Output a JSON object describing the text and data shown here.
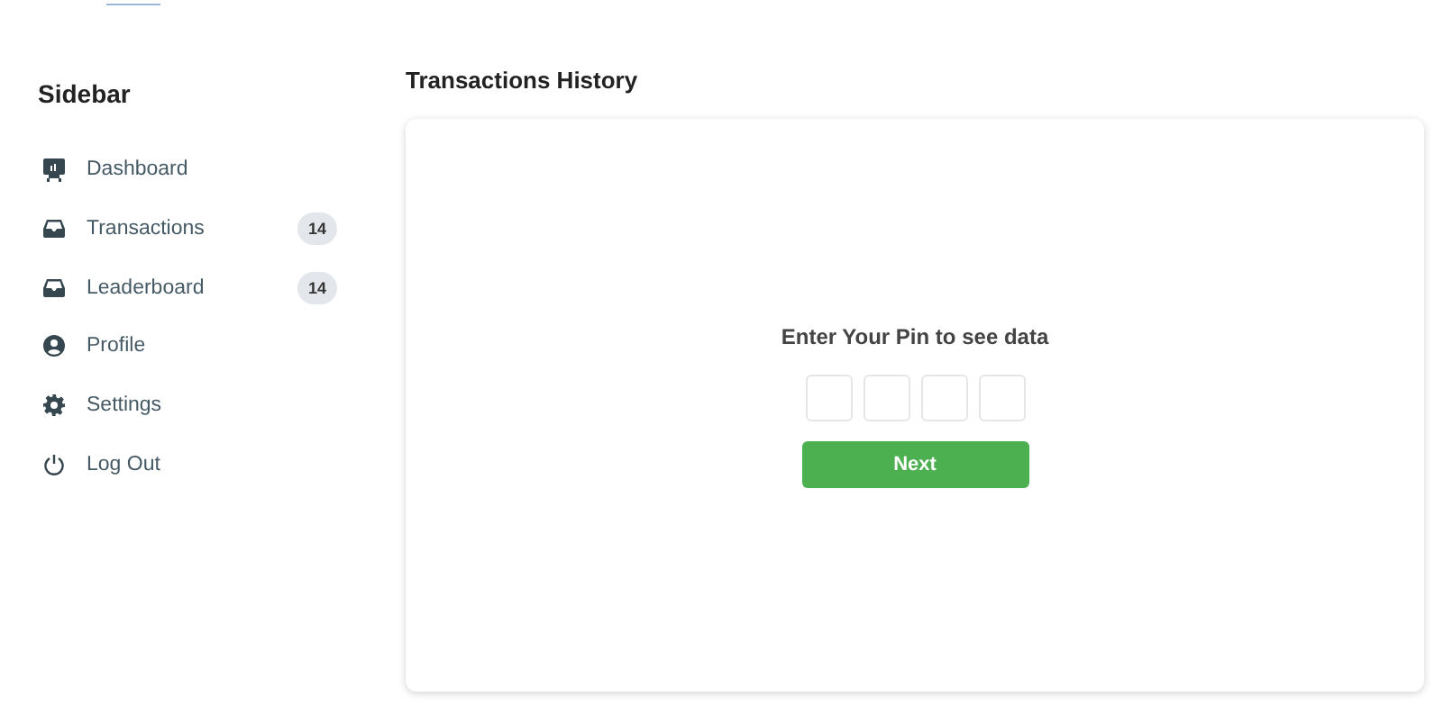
{
  "sidebar": {
    "title": "Sidebar",
    "items": [
      {
        "label": "Dashboard"
      },
      {
        "label": "Transactions",
        "badge": "14"
      },
      {
        "label": "Leaderboard",
        "badge": "14"
      },
      {
        "label": "Profile"
      },
      {
        "label": "Settings"
      },
      {
        "label": "Log Out"
      }
    ]
  },
  "page": {
    "title": "Transactions History"
  },
  "pin_card": {
    "prompt": "Enter Your Pin to see data",
    "button": "Next"
  }
}
